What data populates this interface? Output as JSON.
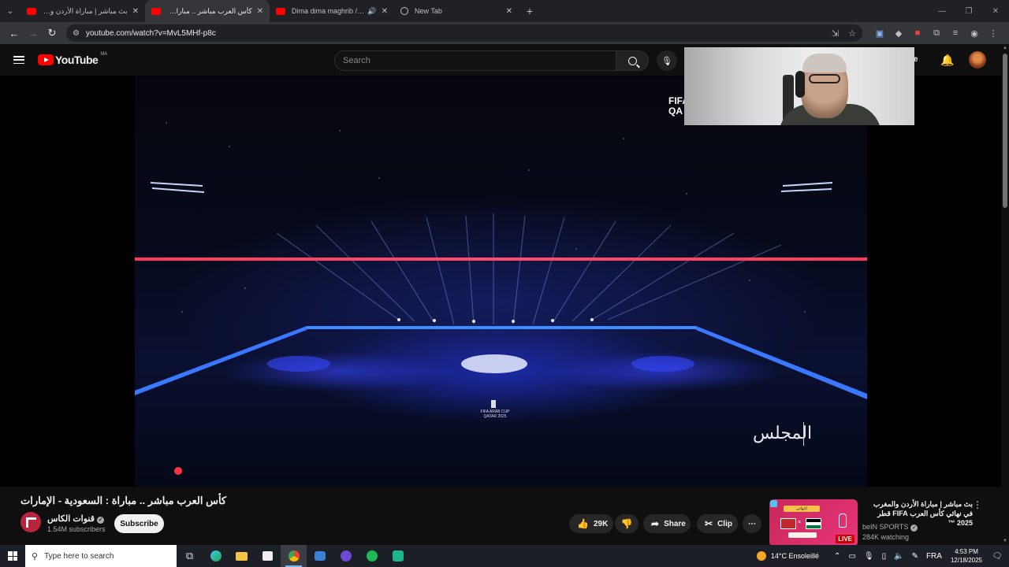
{
  "browser": {
    "tabs": [
      {
        "title": "بث مباشر | مباراة الأردن والمغرب",
        "active": false,
        "icon": "youtube-icon",
        "audio": false
      },
      {
        "title": "كأس العرب مباشر .. مباراة : السعو",
        "active": true,
        "icon": "youtube-icon",
        "audio": false
      },
      {
        "title": "Dima dima maghrib / Dima",
        "active": false,
        "icon": "youtube-icon",
        "audio": true
      },
      {
        "title": "New Tab",
        "active": false,
        "icon": "globe-icon",
        "audio": false
      }
    ],
    "url": "youtube.com/watch?v=MvL5MHf-p8c"
  },
  "youtube": {
    "logo_text": "YouTube",
    "country_code": "MA",
    "search_placeholder": "Search",
    "create_label": "ate"
  },
  "video": {
    "corner_brand": "FIFA",
    "corner_brand2": "QA",
    "cup_label_line1": "FIFA ARAB CUP",
    "cup_label_line2": "QATAR 2025",
    "watermark": "المجلس",
    "title": "كأس العرب مباشر .. مباراة : السعودية - الإمارات",
    "channel": "قنوات الكاس",
    "subscribers": "1.54M subscribers",
    "subscribe_label": "Subscribe",
    "likes": "29K",
    "share_label": "Share",
    "clip_label": "Clip"
  },
  "recommended": {
    "title": "بث مباشر | مباراة الأردن والمغرب في نهائي كأس العرب FIFA قطر 2025 ™",
    "channel": "beIN SPORTS",
    "views": "284K watching",
    "live_label": "LIVE",
    "thumb_banner": "النهائي"
  },
  "taskbar": {
    "search_placeholder": "Type here to search",
    "weather": "14°C  Ensoleillé",
    "language": "FRA",
    "time": "4:53 PM",
    "date": "12/18/2025"
  },
  "colors": {
    "youtube_red": "#ff0000",
    "channel_red": "#b8233d",
    "taskbar_bg": "#1c1f26"
  }
}
